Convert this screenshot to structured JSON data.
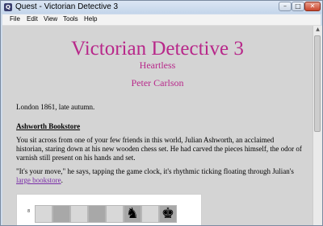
{
  "window": {
    "title": "Quest - Victorian Detective 3",
    "controls": {
      "minimize": "–",
      "maximize": "□",
      "close": "✕"
    },
    "menu": [
      "File",
      "Edit",
      "View",
      "Tools",
      "Help"
    ]
  },
  "game": {
    "title": "Victorian Detective 3",
    "subtitle": "Heartless",
    "author": "Peter Carlson",
    "intro": "London 1861, late autumn.",
    "location": "Ashworth Bookstore",
    "para1": "You sit across from one of your few friends in this world, Julian Ashworth, an acclaimed historian, staring down at his new wooden chess set. He had carved the pieces himself, the odor of varnish still present on his hands and set.",
    "para2_before": "\"It's your move,\" he says, tapping the game clock, it's rhythmic ticking floating through Julian's ",
    "para2_link": "large bookstore",
    "para2_after": ".",
    "board_rank": "8",
    "board_squares": [
      "",
      "",
      "",
      "",
      "",
      "♞",
      "",
      "♚"
    ]
  },
  "colors": {
    "heading": "#b8288a",
    "link": "#7a2ea8",
    "page_bg": "#d4d4d4"
  }
}
